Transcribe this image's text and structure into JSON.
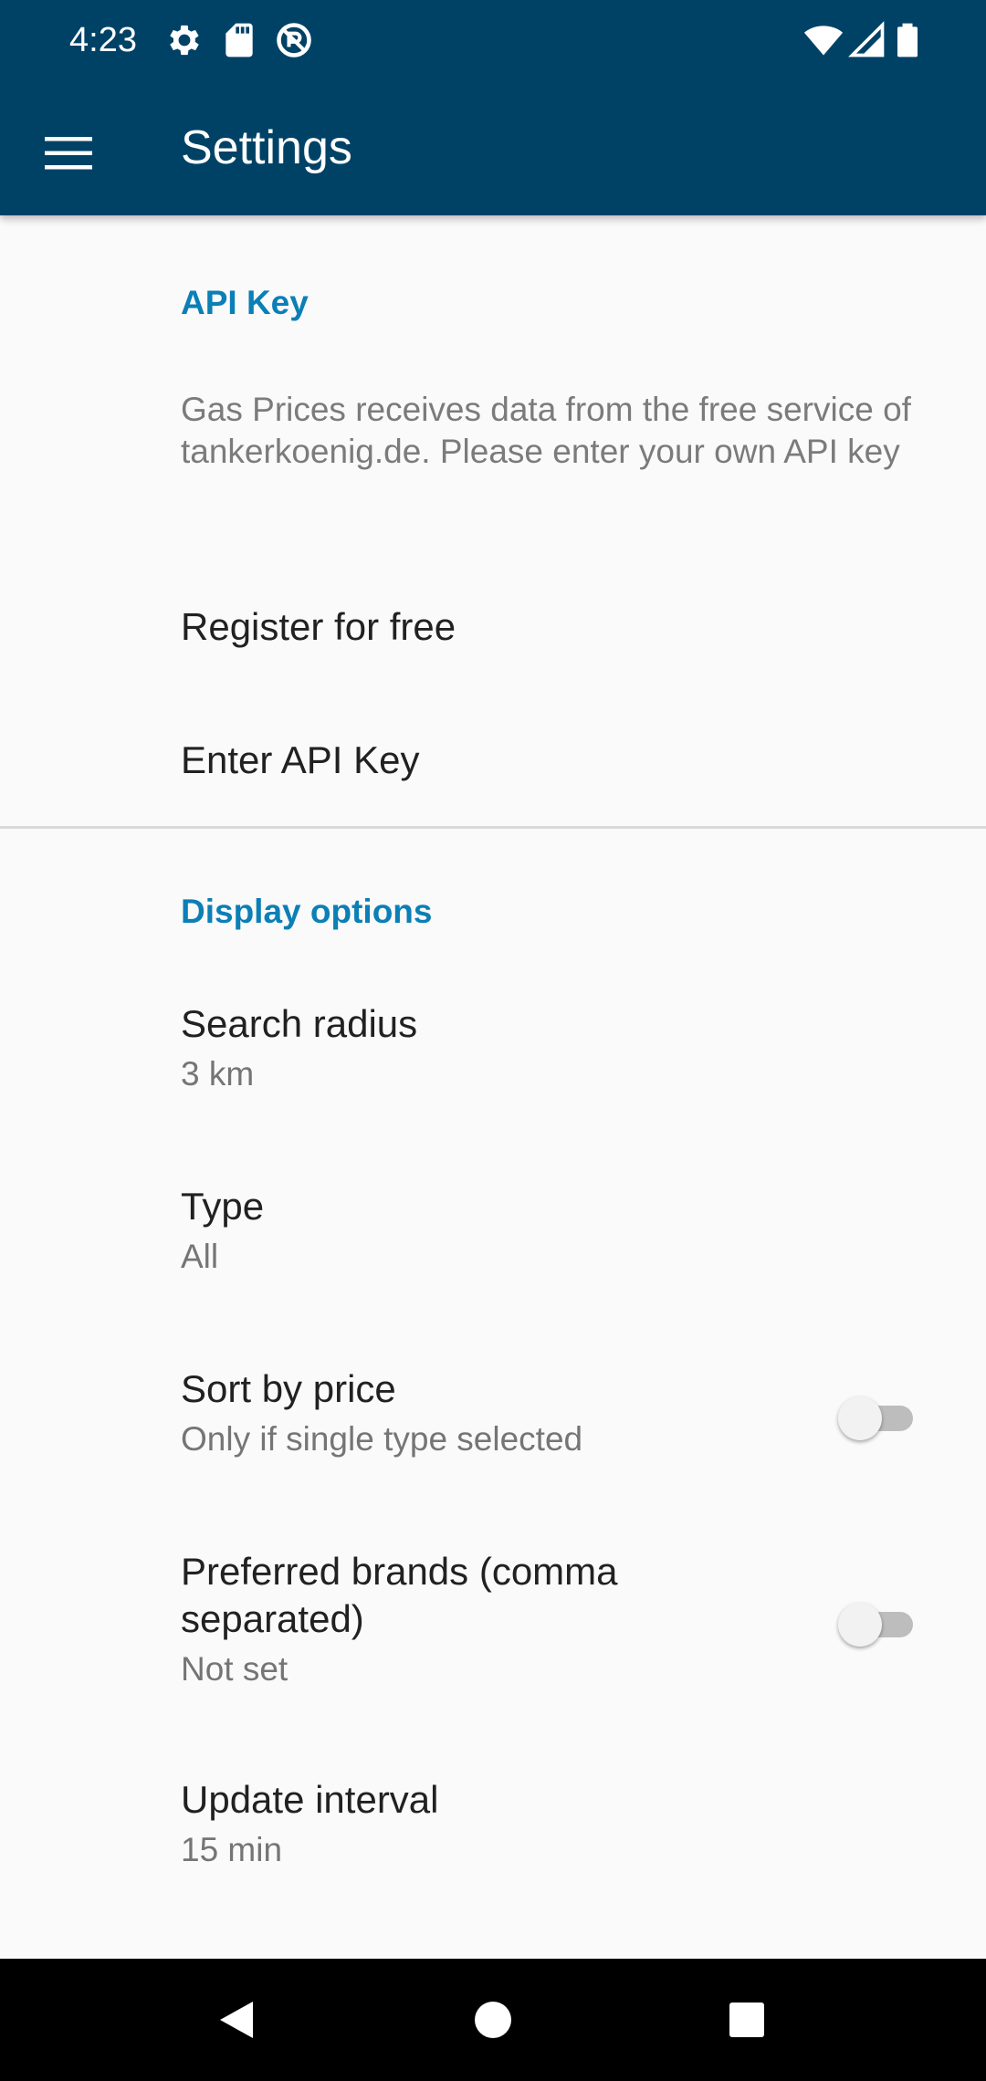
{
  "status_bar": {
    "time": "4:23",
    "icons": [
      "settings-icon",
      "sd-card-icon",
      "vpn-blocked-icon",
      "wifi-icon",
      "cellular-signal-icon",
      "battery-icon"
    ]
  },
  "toolbar": {
    "menu_icon": "hamburger-menu-icon",
    "title": "Settings"
  },
  "colors": {
    "app_bar": "#004266",
    "accent": "#0b7fb6",
    "background": "#fafafa",
    "nav_bar": "#000000"
  },
  "sections": {
    "api_key": {
      "header": "API Key",
      "description": "Gas Prices receives data from the free service of tankerkoenig.de. Please enter your own API key",
      "register": {
        "title": "Register for free"
      },
      "enter_key": {
        "title": "Enter API Key"
      }
    },
    "display": {
      "header": "Display options",
      "search_radius": {
        "title": "Search radius",
        "summary": "3 km"
      },
      "type": {
        "title": "Type",
        "summary": "All"
      },
      "sort_by_price": {
        "title": "Sort by price",
        "summary": "Only if single type selected",
        "checked": false
      },
      "preferred_brands": {
        "title": "Preferred brands (comma separated)",
        "summary": "Not set",
        "checked": false
      },
      "update_interval": {
        "title": "Update interval",
        "summary": "15 min"
      }
    }
  },
  "nav_bar": {
    "icons": [
      "back-icon",
      "home-icon",
      "recents-icon"
    ]
  }
}
